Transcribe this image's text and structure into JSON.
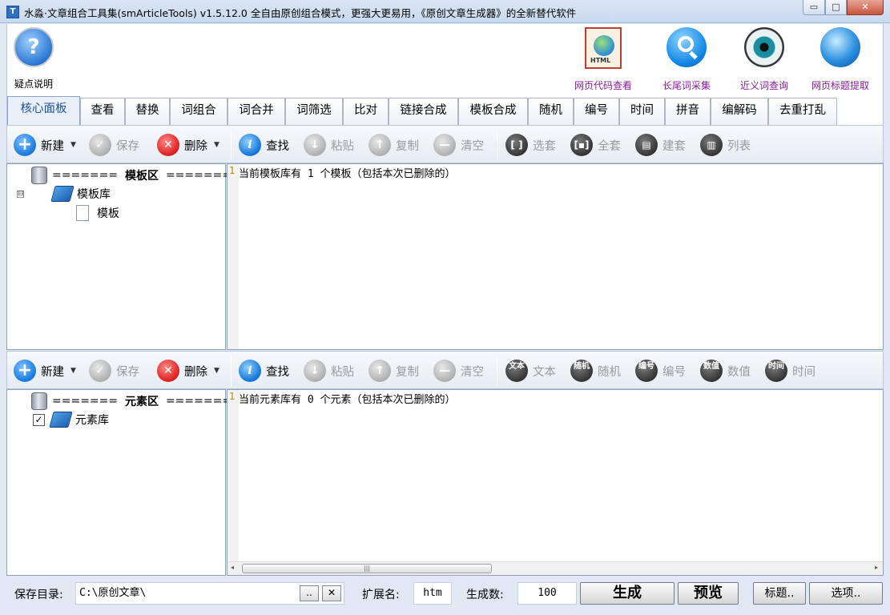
{
  "window": {
    "title": "水淼·文章组合工具集(smArticleTools) v1.5.12.0",
    "slogan": "全自由原创组合模式，更强大更易用，《原创文章生成器》的全新替代软件",
    "buttons": {
      "minimize": "▭",
      "maximize": "□",
      "close": "✕"
    }
  },
  "header": {
    "help_label": "疑点说明",
    "tools": [
      {
        "label": "网页代码查看",
        "icon": "html-page-icon"
      },
      {
        "label": "长尾词采集",
        "icon": "search-icon"
      },
      {
        "label": "近义词查询",
        "icon": "eye-icon"
      },
      {
        "label": "网页标题提取",
        "icon": "web-globe-icon"
      }
    ],
    "html_tag": "HTML",
    "help_glyph": "?"
  },
  "tabs": [
    "核心面板",
    "查看",
    "替换",
    "词组合",
    "词合并",
    "词筛选",
    "比对",
    "链接合成",
    "模板合成",
    "随机",
    "编号",
    "时间",
    "拼音",
    "编解码",
    "去重打乱"
  ],
  "active_tab": "核心面板",
  "toolbar1": {
    "new": "新建",
    "save": "保存",
    "delete": "删除",
    "find": "查找",
    "paste": "粘贴",
    "copy": "复制",
    "clear": "清空",
    "select_set": "选套",
    "all_set": "全套",
    "build_set": "建套",
    "list": "列表",
    "icon_glyphs": {
      "new": "+",
      "save": "✓",
      "delete": "✕",
      "find": "i",
      "paste": "↓",
      "copy": "↑",
      "clear": "—"
    }
  },
  "toolbar2": {
    "new": "新建",
    "save": "保存",
    "delete": "删除",
    "find": "查找",
    "paste": "粘贴",
    "copy": "复制",
    "clear": "清空",
    "text": "文本",
    "random": "随机",
    "number": "编号",
    "value": "数值",
    "time": "时间",
    "icon_glyphs": {
      "text": "文本",
      "random": "随机",
      "number": "编号",
      "value": "数值",
      "time": "时间"
    }
  },
  "template_panel": {
    "header_left": "=======",
    "header_title": "模板区",
    "header_right": "=======",
    "expand_glyph": "⊟",
    "library": "模板库",
    "child": "模板",
    "editor_line_num": "1",
    "editor_text": "当前模板库有 1 个模板（包括本次已删除的）"
  },
  "element_panel": {
    "header_left": "=======",
    "header_title": "元素区",
    "header_right": "=======",
    "library": "元素库",
    "library_checked": true,
    "check_glyph": "✓",
    "editor_line_num": "1",
    "editor_text": "当前元素库有 0 个元素（包括本次已删除的）"
  },
  "scrollbar": {
    "left": "◂",
    "grip": "|||",
    "right": "▸"
  },
  "bottom": {
    "save_dir_label": "保存目录:",
    "save_dir_value": "C:\\原创文章\\",
    "browse": "..",
    "clear": "✕",
    "ext_label": "扩展名:",
    "ext_value": "htm",
    "count_label": "生成数:",
    "count_value": "100",
    "generate": "生成",
    "preview": "预览",
    "title_btn": "标题..",
    "options_btn": "选项.."
  },
  "colors": {
    "accent_purple": "#8b1c9b",
    "active_tab_text": "#1a4f9c"
  }
}
